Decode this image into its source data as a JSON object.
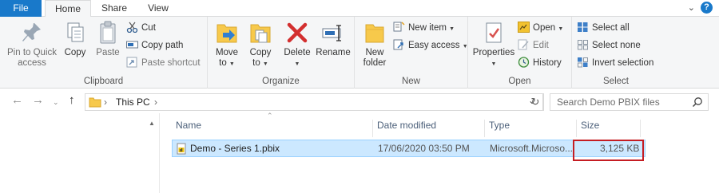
{
  "tabs": {
    "file": "File",
    "home": "Home",
    "share": "Share",
    "view": "View"
  },
  "window_controls": {
    "chevron": "⌄",
    "help": "?"
  },
  "ribbon": {
    "clipboard": {
      "label": "Clipboard",
      "pin": "Pin to Quick access",
      "pin_line1": "Pin to Quick",
      "pin_line2": "access",
      "copy": "Copy",
      "paste": "Paste",
      "cut": "Cut",
      "copy_path": "Copy path",
      "paste_shortcut": "Paste shortcut"
    },
    "organize": {
      "label": "Organize",
      "move_to_1": "Move",
      "move_to_2": "to",
      "copy_to_1": "Copy",
      "copy_to_2": "to",
      "delete": "Delete",
      "rename": "Rename"
    },
    "new": {
      "label": "New",
      "new_folder_1": "New",
      "new_folder_2": "folder",
      "new_item": "New item",
      "easy_access": "Easy access"
    },
    "open": {
      "label": "Open",
      "properties": "Properties",
      "open": "Open",
      "edit": "Edit",
      "history": "History"
    },
    "select": {
      "label": "Select",
      "select_all": "Select all",
      "select_none": "Select none",
      "invert": "Invert selection"
    }
  },
  "address": {
    "path": "This PC",
    "separator": "›",
    "search_placeholder": "Search Demo PBIX files"
  },
  "columns": {
    "name": "Name",
    "date": "Date modified",
    "type": "Type",
    "size": "Size"
  },
  "files": [
    {
      "name": "Demo - Series 1.pbix",
      "date": "17/06/2020 03:50 PM",
      "type": "Microsoft.Microso...",
      "size": "3,125 KB"
    }
  ],
  "colors": {
    "accent": "#1979ca",
    "selection": "#cce8ff",
    "highlight_box": "#c51d23",
    "delete_x": "#d32f2f",
    "folder": "#f7c94b"
  }
}
